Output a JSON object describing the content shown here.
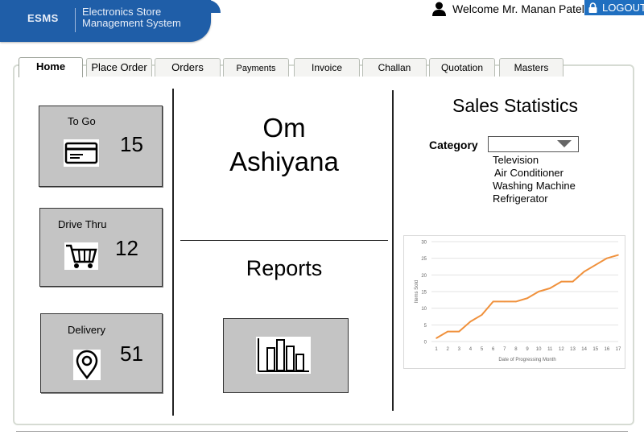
{
  "header": {
    "brand_abbr": "ESMS",
    "brand_name_line1": "Electronics Store",
    "brand_name_line2": "Management System",
    "welcome_text": "Welcome Mr. Manan Patel",
    "logout_label": "LOGOUT",
    "user_icon": "user-icon",
    "logout_icon": "lock-icon"
  },
  "tabs": [
    {
      "label": "Home",
      "active": true
    },
    {
      "label": "Place Order"
    },
    {
      "label": "Orders"
    },
    {
      "label": "Payments"
    },
    {
      "label": "Invoice"
    },
    {
      "label": "Challan"
    },
    {
      "label": "Quotation"
    },
    {
      "label": "Masters"
    }
  ],
  "orders": {
    "to_go": {
      "label": "To Go",
      "count": "15",
      "icon": "credit-card-icon"
    },
    "drive_thru": {
      "label": "Drive Thru",
      "count": "12",
      "icon": "shopping-cart-icon"
    },
    "delivery": {
      "label": "Delivery",
      "count": "51",
      "icon": "location-pin-icon"
    }
  },
  "store": {
    "name_line1": "Om",
    "name_line2": "Ashiyana"
  },
  "reports": {
    "title": "Reports",
    "icon": "bar-chart-icon"
  },
  "sales": {
    "title": "Sales Statistics",
    "category_label": "Category",
    "category_value": "",
    "category_options": [
      "Television",
      "Air Conditioner",
      "Washing Machine",
      "Refrigerator"
    ]
  },
  "colors": {
    "brand_blue": "#1f5ea8",
    "card_gray": "#c4c4c4",
    "line_orange": "#f0913c"
  },
  "chart_data": {
    "type": "line",
    "xlabel": "Date of Progressing Month",
    "ylabel": "Items Sold",
    "x": [
      1,
      2,
      3,
      4,
      5,
      6,
      7,
      8,
      9,
      10,
      11,
      12,
      13,
      14,
      15,
      16,
      17
    ],
    "series": [
      {
        "values": [
          1,
          3,
          3,
          6,
          8,
          12,
          12,
          12,
          13,
          15,
          16,
          18,
          18,
          21,
          23,
          25,
          26
        ]
      }
    ],
    "ylim": [
      0,
      30
    ],
    "yticks": [
      0,
      5,
      10,
      15,
      20,
      25,
      30
    ],
    "grid": true
  }
}
